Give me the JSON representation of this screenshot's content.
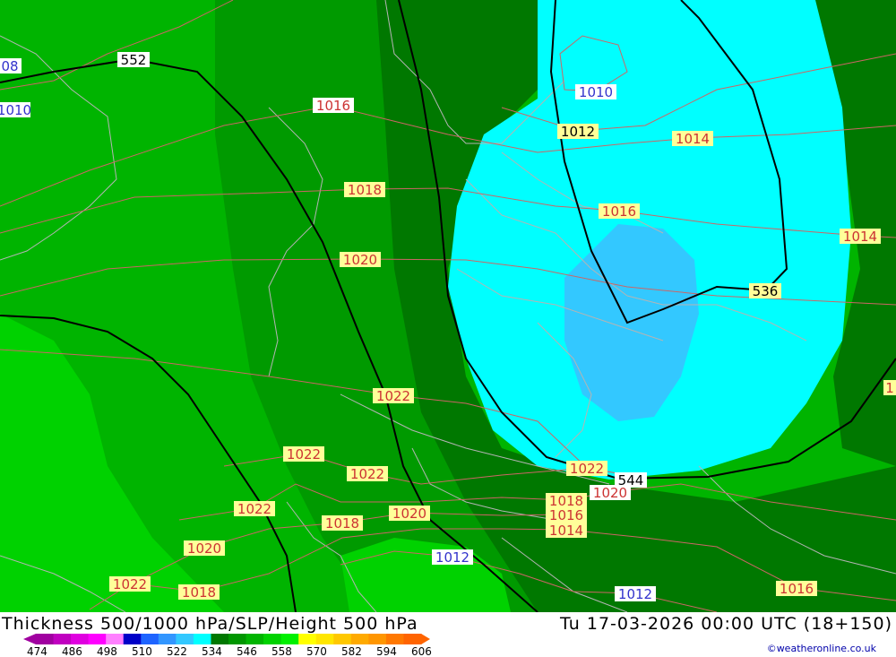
{
  "map": {
    "thickness_labels": [
      "552",
      "536",
      "544"
    ],
    "isobar_labels": [
      "1016",
      "1018",
      "1020",
      "1022",
      "1022",
      "1022",
      "1022",
      "1020",
      "1020",
      "1018",
      "1022",
      "1018",
      "1018",
      "1016",
      "1014",
      "1014",
      "1014",
      "1016",
      "1016",
      "1012",
      "1010",
      "1012",
      "1012",
      "1010",
      "08",
      "1022",
      "1020",
      "1"
    ],
    "colors": {
      "thickness_low_cyan": "#00ffff",
      "thickness_lower_blue": "#33c8ff",
      "thickness_green_1": "#009a00",
      "thickness_green_2": "#00b400",
      "thickness_green_3": "#00d200",
      "thickness_green_4": "#007800",
      "thickness_contour": "#000000",
      "isobar_line": "#cc6666",
      "isobar_label_bg": "#ffff99",
      "border_line": "#b4b4b4"
    }
  },
  "footer": {
    "title": "Thickness 500/1000 hPa/SLP/Height 500 hPa",
    "datetime": "Tu 17-03-2026 00:00 UTC (18+150)",
    "credit": "©weatheronline.co.uk",
    "scale_values": [
      "474",
      "486",
      "498",
      "510",
      "522",
      "534",
      "546",
      "558",
      "570",
      "582",
      "594",
      "606"
    ],
    "scale_colors": [
      "#a000a0",
      "#c000c0",
      "#e000e0",
      "#ff00ff",
      "#ff80ff",
      "#0000c8",
      "#1e64ff",
      "#3296ff",
      "#32c8ff",
      "#00ffff",
      "#007800",
      "#009600",
      "#00b400",
      "#00d200",
      "#00f000",
      "#ffff00",
      "#ffe600",
      "#ffc800",
      "#ffaa00",
      "#ff9600",
      "#ff7800",
      "#ff6400"
    ]
  }
}
